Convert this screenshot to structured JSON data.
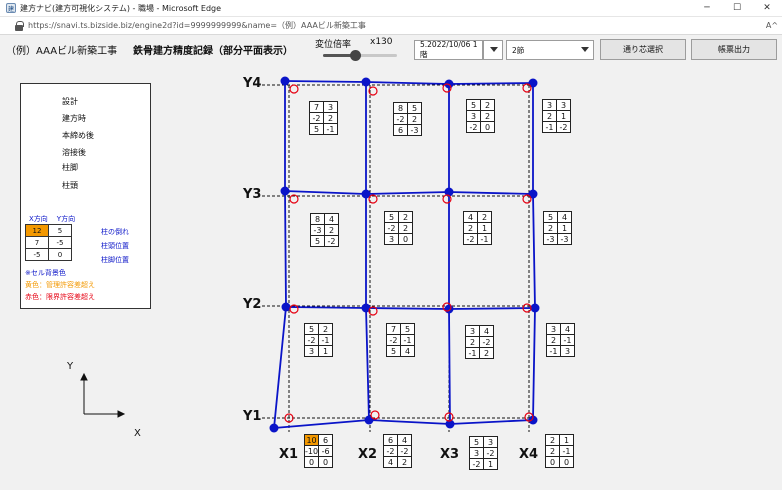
{
  "window": {
    "title": "建方ナビ(建方可視化システム) - 職場 - Microsoft Edge",
    "icon_label": "建",
    "minimize": "─",
    "maximize": "☐",
    "close": "✕"
  },
  "address": {
    "url": "https://snavi.ts.bizside.biz/engine2d?id=9999999999&name=（例）AAAビル新築工事",
    "read_icon": "A^"
  },
  "toolbar": {
    "project": "（例）AAAビル新築工事",
    "title": "鉄骨建方精度記録（部分平面表示）",
    "zoom_label": "変位倍率",
    "zoom_value": "x130",
    "date_value": "5.2022/10/06 1階",
    "node_value": "2節",
    "axis_select_button": "通り芯選択",
    "report_button": "帳票出力"
  },
  "legend": {
    "design": "設計",
    "erection": "建方時",
    "final_tight": "本締め後",
    "after_weld": "溶接後",
    "column_base": "柱脚",
    "column_head": "柱頭",
    "x_dir": "X方向",
    "y_dir": "Y方向",
    "sample": [
      [
        "12",
        "5"
      ],
      [
        "7",
        "-5"
      ],
      [
        "-5",
        "0"
      ]
    ],
    "row_notes": [
      "柱の倒れ",
      "柱頭位置",
      "柱脚位置"
    ],
    "note1": "※セル背景色",
    "note2": "黄色：管理許容差超え",
    "note3": "赤色：限界許容差超え",
    "colors": {
      "design": "#111111",
      "erection": "#0a14c8",
      "final_tight": "#128c12",
      "after_weld": "#e60012",
      "highlight": "#f39800"
    }
  },
  "axes": {
    "x": [
      "X1",
      "X2",
      "X3",
      "X4"
    ],
    "y": [
      "Y4",
      "Y3",
      "Y2",
      "Y1"
    ]
  },
  "compass": {
    "y": "Y",
    "x": "X"
  },
  "cells": [
    {
      "key": "c-y4-x1",
      "v": [
        [
          "7",
          "3"
        ],
        [
          "-2",
          "2"
        ],
        [
          "5",
          "-1"
        ]
      ]
    },
    {
      "key": "c-y4-x2",
      "v": [
        [
          "8",
          "5"
        ],
        [
          "-2",
          "2"
        ],
        [
          "6",
          "-3"
        ]
      ]
    },
    {
      "key": "c-y4-x3",
      "v": [
        [
          "5",
          "2"
        ],
        [
          "3",
          "2"
        ],
        [
          "-2",
          "0"
        ]
      ]
    },
    {
      "key": "c-y4-x4",
      "v": [
        [
          "3",
          "3"
        ],
        [
          "2",
          "1"
        ],
        [
          "-1",
          "-2"
        ]
      ]
    },
    {
      "key": "c-y3-x1",
      "v": [
        [
          "8",
          "4"
        ],
        [
          "-3",
          "2"
        ],
        [
          "5",
          "-2"
        ]
      ]
    },
    {
      "key": "c-y3-x2",
      "v": [
        [
          "5",
          "2"
        ],
        [
          "-2",
          "2"
        ],
        [
          "3",
          "0"
        ]
      ]
    },
    {
      "key": "c-y3-x3",
      "v": [
        [
          "4",
          "2"
        ],
        [
          "2",
          "1"
        ],
        [
          "-2",
          "-1"
        ]
      ]
    },
    {
      "key": "c-y3-x4",
      "v": [
        [
          "5",
          "4"
        ],
        [
          "2",
          "1"
        ],
        [
          "-3",
          "-3"
        ]
      ]
    },
    {
      "key": "c-y2-x1",
      "v": [
        [
          "5",
          "2"
        ],
        [
          "-2",
          "-1"
        ],
        [
          "3",
          "1"
        ]
      ]
    },
    {
      "key": "c-y2-x2",
      "v": [
        [
          "7",
          "5"
        ],
        [
          "-2",
          "-1"
        ],
        [
          "5",
          "4"
        ]
      ]
    },
    {
      "key": "c-y2-x3",
      "v": [
        [
          "3",
          "4"
        ],
        [
          "2",
          "-2"
        ],
        [
          "-1",
          "2"
        ]
      ]
    },
    {
      "key": "c-y2-x4",
      "v": [
        [
          "3",
          "4"
        ],
        [
          "2",
          "-1"
        ],
        [
          "-1",
          "3"
        ]
      ]
    },
    {
      "key": "c-y1-x1",
      "v": [
        [
          "10",
          "6"
        ],
        [
          "-10",
          "-6"
        ],
        [
          "0",
          "0"
        ]
      ],
      "hl": true
    },
    {
      "key": "c-y1-x2",
      "v": [
        [
          "6",
          "4"
        ],
        [
          "-2",
          "-2"
        ],
        [
          "4",
          "2"
        ]
      ]
    },
    {
      "key": "c-y1-x3",
      "v": [
        [
          "5",
          "3"
        ],
        [
          "3",
          "-2"
        ],
        [
          "-2",
          "1"
        ]
      ]
    },
    {
      "key": "c-y1-x4",
      "v": [
        [
          "2",
          "1"
        ],
        [
          "2",
          "-1"
        ],
        [
          "0",
          "0"
        ]
      ]
    }
  ]
}
